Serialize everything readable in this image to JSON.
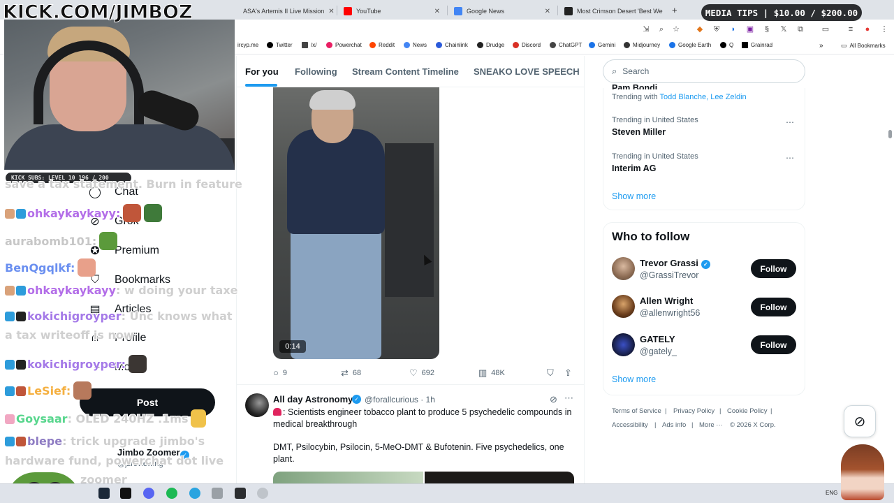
{
  "browser": {
    "tabs": [
      {
        "label": "ASA's Artemis II Live Mission",
        "favicon_color": "#5f6368"
      },
      {
        "label": "YouTube",
        "favicon_color": "#ff0000"
      },
      {
        "label": "Google News",
        "favicon_color": "#4285f4"
      },
      {
        "label": "Most Crimson Desert 'Best We",
        "favicon_color": "#222222"
      }
    ],
    "new_tab_label": "+",
    "bookmarks": [
      {
        "label": "ircyp.me",
        "color": "#888888"
      },
      {
        "label": "Twitter",
        "color": "#000000"
      },
      {
        "label": "/x/",
        "color": "#444444"
      },
      {
        "label": "Powerchat",
        "color": "#e91e63"
      },
      {
        "label": "Reddit",
        "color": "#ff4500"
      },
      {
        "label": "News",
        "color": "#4285f4"
      },
      {
        "label": "Chainlink",
        "color": "#2a5ada"
      },
      {
        "label": "Drudge",
        "color": "#222222"
      },
      {
        "label": "Discord",
        "color": "#d93025"
      },
      {
        "label": "ChatGPT",
        "color": "#444444"
      },
      {
        "label": "Gemini",
        "color": "#1a73e8"
      },
      {
        "label": "Midjourney",
        "color": "#333333"
      },
      {
        "label": "Google Earth",
        "color": "#1a73e8"
      },
      {
        "label": "Q",
        "color": "#000000"
      },
      {
        "label": "Grainrad",
        "color": "#000000"
      }
    ],
    "all_bookmarks_label": "All Bookmarks"
  },
  "stream_overlay": {
    "banner": "KICK.COM/JIMBOZ",
    "subs_bar": "KICK SUBS: LEVEL 10 196 / 200",
    "tips_bar": "MEDIA TIPS | $10.00 / $200.00",
    "chat": [
      {
        "user": "",
        "text": "save a tax statement. Burn in feature",
        "color": "#cfcfcf"
      },
      {
        "user": "ohkaykaykayy",
        "text": ":",
        "color": "#b36ee8"
      },
      {
        "user": "aurabomb101",
        "text": ":",
        "color": "#c7c7c7"
      },
      {
        "user": "BenQgqlkf",
        "text": ":",
        "color": "#6a8ff0"
      },
      {
        "user": "ohkaykaykayy",
        "text": ": w doing your taxe",
        "color": "#b36ee8"
      },
      {
        "user": "kokichigroyper",
        "text": ": Unc knows what",
        "color": "#a57ae8"
      },
      {
        "user": "",
        "text": "a tax writeoff is now",
        "color": "#cfcfcf"
      },
      {
        "user": "kokichigroyper",
        "text": ":",
        "color": "#a57ae8"
      },
      {
        "user": "LeSief",
        "text": ":",
        "color": "#f5b041"
      },
      {
        "user": "Goysaar",
        "text": ": OLED 240HZ .1ms",
        "color": "#58d68d"
      },
      {
        "user": "blepe",
        "text": ": trick upgrade jimbo's",
        "color": "#8e7cc3"
      },
      {
        "user": "",
        "text": "hardware fund, powerchat dot live",
        "color": "#cfcfcf"
      },
      {
        "user": "",
        "text": "zoomer",
        "color": "#cfcfcf"
      }
    ]
  },
  "sidebar": {
    "items": [
      {
        "label": "Chat",
        "icon": "chat-icon"
      },
      {
        "label": "Grok",
        "icon": "grok-icon"
      },
      {
        "label": "Premium",
        "icon": "premium-icon"
      },
      {
        "label": "Bookmarks",
        "icon": "bookmark-icon"
      },
      {
        "label": "Articles",
        "icon": "articles-icon"
      },
      {
        "label": "Profile",
        "icon": "profile-icon"
      },
      {
        "label": "More",
        "icon": "more-icon"
      }
    ],
    "post_label": "Post",
    "account_name": "Jimbo Zoomer",
    "account_handle": "@jzreviewing"
  },
  "feed": {
    "tabs": [
      "For you",
      "Following",
      "Stream Content Timeline",
      "SNEAKO LOVE SPEECH"
    ],
    "active_tab": "For you",
    "video_duration": "0:14",
    "actions": {
      "replies": "9",
      "reposts": "68",
      "likes": "692",
      "views": "48K"
    },
    "tweet2": {
      "name": "All day Astronomy",
      "handle": "@forallcurious",
      "time": "· 1h",
      "line1": ": Scientists engineer tobacco plant to produce 5 psychedelic compounds in medical breakthrough",
      "line2": "DMT, Psilocybin, Psilocin, 5-MeO-DMT & Bufotenin. Five psychedelics, one plant."
    }
  },
  "right": {
    "search_placeholder": "Search",
    "trends": {
      "partial_title": "Pam Bondi",
      "trending_with_label": "Trending with",
      "trending_with_1": "Todd Blanche",
      "trending_with_sep": ",",
      "trending_with_2": "Lee Zeldin",
      "items": [
        {
          "meta": "Trending in United States",
          "title": "Steven Miller"
        },
        {
          "meta": "Trending in United States",
          "title": "Interim AG"
        }
      ],
      "show_more": "Show more"
    },
    "who_to_follow": {
      "title": "Who to follow",
      "follow_label": "Follow",
      "accounts": [
        {
          "name": "Trevor Grassi",
          "handle": "@GrassiTrevor",
          "verified": true
        },
        {
          "name": "Allen Wright",
          "handle": "@allenwright56",
          "verified": false
        },
        {
          "name": "GATELY",
          "handle": "@gately_",
          "verified": false
        }
      ],
      "show_more": "Show more"
    },
    "footer": [
      "Terms of Service",
      "|",
      "Privacy Policy",
      "|",
      "Cookie Policy",
      "|",
      "Accessibility",
      "|",
      "Ads info",
      "|",
      "More ···",
      "© 2026 X Corp."
    ]
  },
  "taskbar": {
    "lang": "ENG"
  }
}
